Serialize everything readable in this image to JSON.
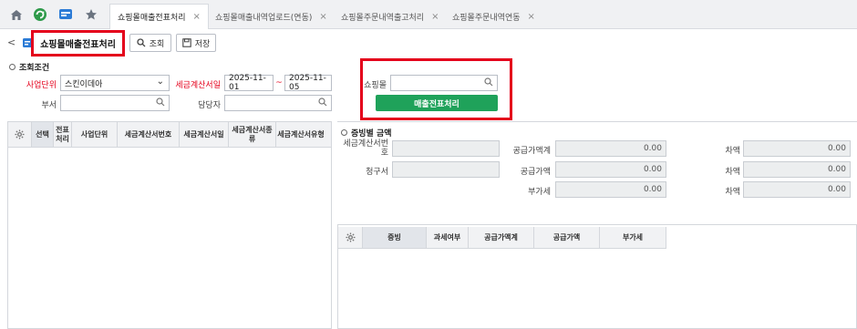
{
  "tabs": [
    {
      "label": "쇼핑몰매출전표처리",
      "active": true
    },
    {
      "label": "쇼핑몰매출내역업로드(연동)",
      "active": false
    },
    {
      "label": "쇼핑몰주문내역출고처리",
      "active": false
    },
    {
      "label": "쇼핑몰주문내역연동",
      "active": false
    }
  ],
  "icons": {
    "home": "home-icon",
    "app1": "refresh-app-icon",
    "app2": "window-app-icon",
    "star": "star-icon"
  },
  "page": {
    "title": "쇼핑몰매출전표처리",
    "search_label": "조회",
    "save_label": "저장"
  },
  "conditions": {
    "title": "조회조건",
    "business_unit_label": "사업단위",
    "business_unit_value": "스킨이데아",
    "invoice_date_label": "세금계산서일",
    "date_from": "2025-11-01",
    "date_sep": "~",
    "date_to": "2025-11-05",
    "dept_label": "부서",
    "manager_label": "담당자",
    "mall_label": "쇼핑몰",
    "process_button": "매출전표처리"
  },
  "left_grid": {
    "columns": [
      "선택",
      "전표처리",
      "사업단위",
      "세금계산서번호",
      "세금계산서일",
      "세금계산서종류",
      "세금계산서유형"
    ]
  },
  "amounts": {
    "title": "증빙별 금액",
    "invoice_no_label": "세금계산서번호",
    "claim_label": "청구서",
    "supply_total_label": "공급가액계",
    "supply_label": "공급가액",
    "vat_label": "부가세",
    "diff_label": "차액",
    "supply_total_value": "0.00",
    "supply_value": "0.00",
    "vat_value": "0.00",
    "diff1_value": "0.00",
    "diff2_value": "0.00",
    "diff3_value": "0.00"
  },
  "right_grid": {
    "columns": [
      "증빙",
      "과세여부",
      "공급가액계",
      "공급가액",
      "부가세"
    ]
  }
}
